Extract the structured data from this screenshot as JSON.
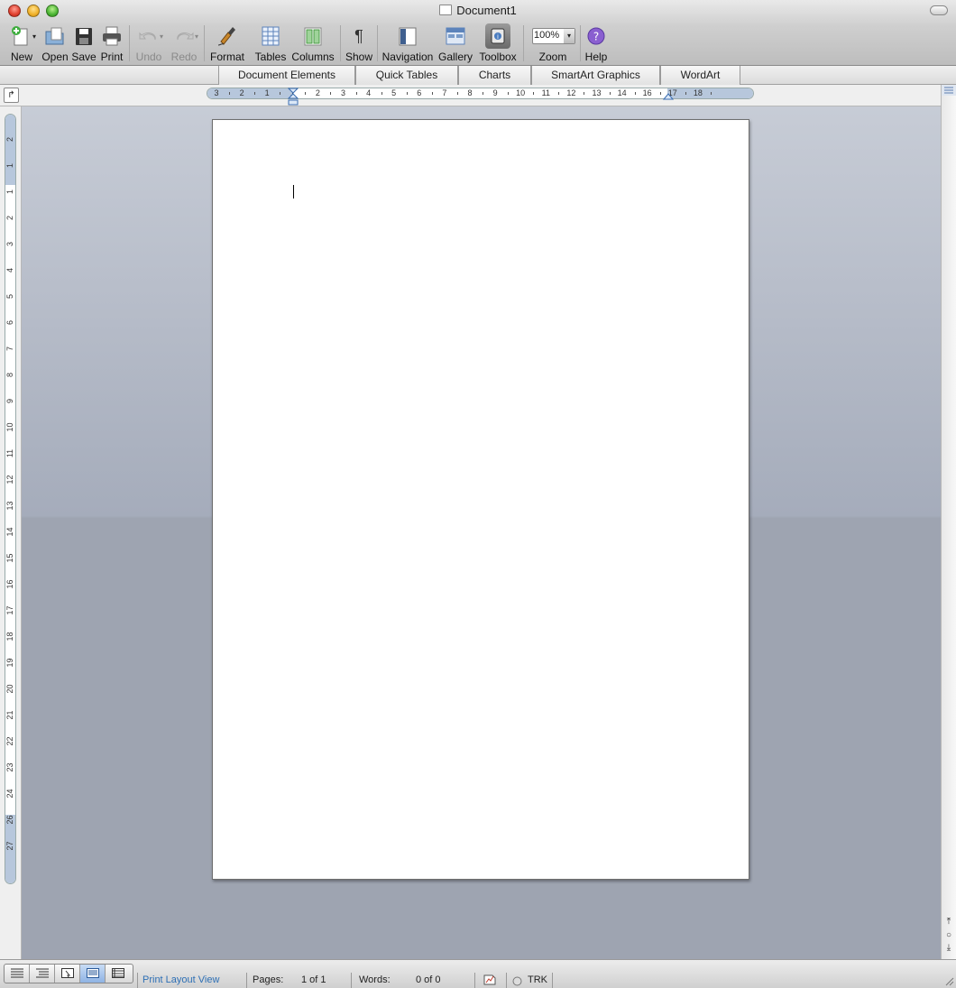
{
  "window": {
    "title": "Document1"
  },
  "toolbar": {
    "new": "New",
    "open": "Open",
    "save": "Save",
    "print": "Print",
    "undo": "Undo",
    "redo": "Redo",
    "format": "Format",
    "tables": "Tables",
    "columns": "Columns",
    "show": "Show",
    "navigation": "Navigation",
    "gallery": "Gallery",
    "toolbox": "Toolbox",
    "zoom": "Zoom",
    "help": "Help",
    "zoom_value": "100%"
  },
  "ribbon": {
    "tabs": [
      "Document Elements",
      "Quick Tables",
      "Charts",
      "SmartArt Graphics",
      "WordArt"
    ]
  },
  "hruler": {
    "labels": [
      "3",
      "2",
      "1",
      "1",
      "2",
      "3",
      "4",
      "5",
      "6",
      "7",
      "8",
      "9",
      "10",
      "11",
      "12",
      "13",
      "14",
      "16",
      "17",
      "18"
    ]
  },
  "vruler": {
    "labels": [
      "2",
      "1",
      "1",
      "2",
      "3",
      "4",
      "5",
      "6",
      "7",
      "8",
      "9",
      "10",
      "11",
      "12",
      "13",
      "14",
      "15",
      "16",
      "17",
      "18",
      "19",
      "20",
      "21",
      "22",
      "23",
      "24",
      "26",
      "27"
    ]
  },
  "status": {
    "view_name": "Print Layout View",
    "pages_label": "Pages:",
    "pages_value": "1 of 1",
    "words_label": "Words:",
    "words_value": "0 of 0",
    "track": "TRK"
  },
  "colors": {
    "accent": "#2d6fb5",
    "margin": "#b7c7dc",
    "workspace_top": "#c7ccd6",
    "workspace_bottom": "#9ea4b1"
  }
}
